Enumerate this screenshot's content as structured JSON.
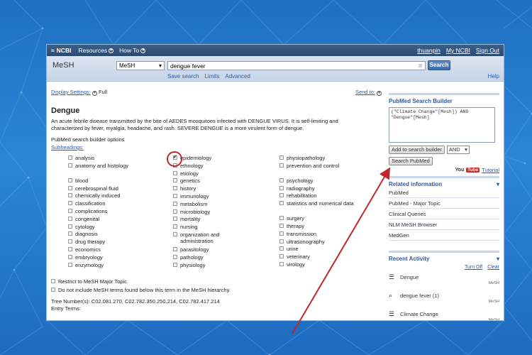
{
  "ncbi": {
    "logo": "NCBI",
    "resources": "Resources",
    "howto": "How To",
    "user": "thuanpin",
    "my_ncbi": "My NCBI",
    "sign_out": "Sign Out"
  },
  "search": {
    "db_label": "MeSH",
    "db_select": "MeSH",
    "query": "dengue fever",
    "button": "Search",
    "links": [
      "Save search",
      "Limits",
      "Advanced"
    ],
    "help": "Help"
  },
  "display": {
    "settings_label": "Display Settings:",
    "settings_value": "Full",
    "send_to": "Send to:"
  },
  "term": {
    "title": "Dengue",
    "description": "An acute febrile disease transmitted by the bite of AEDES mosquitoes infected with DENGUE VIRUS. It is self-limiting and characterized by fever, myalgia, headache, and rash. SEVERE DENGUE is a more virulent form of dengue.",
    "options_label": "PubMed search builder options",
    "subheadings_label": "Subheadings:",
    "col1": [
      "analysis",
      "anatomy and histology",
      "blood",
      "cerebrospinal fluid",
      "chemically induced",
      "classification",
      "complications",
      "congenital",
      "cytology",
      "diagnosis",
      "drug therapy",
      "economics",
      "embryology",
      "enzymology"
    ],
    "col2": [
      "epidemiology",
      "ethnology",
      "etiology",
      "genetics",
      "history",
      "immunology",
      "metabolism",
      "microbiology",
      "mortality",
      "nursing",
      "organization and administration",
      "parasitology",
      "pathology",
      "physiology"
    ],
    "col3": [
      "physiopathology",
      "prevention and control",
      "psychology",
      "radiography",
      "rehabilitation",
      "statistics and numerical data",
      "surgery",
      "therapy",
      "transmission",
      "ultrasonography",
      "urine",
      "veterinary",
      "virology"
    ],
    "checked_col2_index": 0,
    "restrict_label": "Restrict to MeSH Major Topic.",
    "no_include_label": "Do not include MeSH terms found below this term in the MeSH hierarchy.",
    "tree_label": "Tree Number(s):",
    "tree_value": "C02.081.270, C02.782.350.250.214, C02.782.417.214",
    "entry_terms_label": "Entry Terms:"
  },
  "builder": {
    "title": "PubMed Search Builder",
    "text": "(\"Climate Change\"[Mesh]) AND\n\"Dengue\"[Mesh]",
    "add_button": "Add to search builder",
    "operator": "AND",
    "search_button": "Search PubMed",
    "youtube_you": "You",
    "youtube_tube": "Tube",
    "tutorial": "Tutorial"
  },
  "related": {
    "title": "Related information",
    "items": [
      "PubMed",
      "PubMed - Major Topic",
      "Clinical Queries",
      "NLM MeSH Browser",
      "MedGen"
    ]
  },
  "activity": {
    "title": "Recent Activity",
    "turn_off": "Turn Off",
    "clear": "Clear",
    "items": [
      {
        "label": "Dengue",
        "db": "MeSH"
      },
      {
        "label": "dengue fever (1)",
        "db": "MeSH"
      },
      {
        "label": "Climate Change",
        "db": "MeSH"
      }
    ]
  },
  "colors": {
    "background": "#2a86d6",
    "link": "#2d5aa6",
    "highlight_ring": "#c0272d",
    "arrow": "#c0272d"
  }
}
